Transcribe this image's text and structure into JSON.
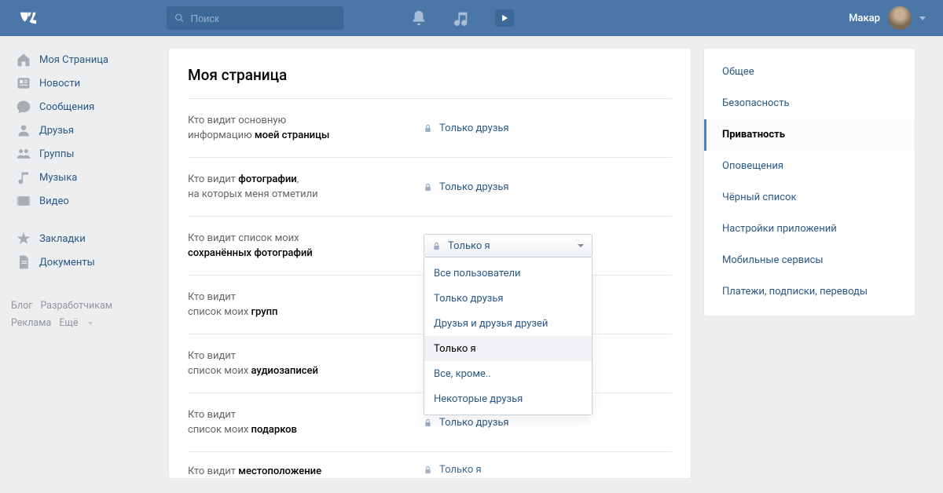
{
  "header": {
    "search_placeholder": "Поиск",
    "username": "Макар"
  },
  "leftnav": {
    "items": [
      {
        "label": "Моя Страница",
        "icon": "home"
      },
      {
        "label": "Новости",
        "icon": "news"
      },
      {
        "label": "Сообщения",
        "icon": "messages"
      },
      {
        "label": "Друзья",
        "icon": "friends"
      },
      {
        "label": "Группы",
        "icon": "groups"
      },
      {
        "label": "Музыка",
        "icon": "music"
      },
      {
        "label": "Видео",
        "icon": "video"
      }
    ],
    "secondary": [
      {
        "label": "Закладки",
        "icon": "bookmarks"
      },
      {
        "label": "Документы",
        "icon": "docs"
      }
    ],
    "footer": {
      "blog": "Блог",
      "developers": "Разработчикам",
      "ads": "Реклама",
      "more": "Ещё"
    }
  },
  "main": {
    "title": "Моя страница",
    "rows": [
      {
        "q1": "Кто видит основную",
        "q2": "информацию ",
        "b": "моей страницы",
        "value": "Только друзья"
      },
      {
        "q1": "Кто видит ",
        "b1": "фотографии",
        "punc": ",",
        "q2": "на которых меня отметили",
        "value": "Только друзья"
      },
      {
        "q1": "Кто видит список моих",
        "q2": "",
        "b": "сохранённых фотографий",
        "value_dd": "Только я"
      },
      {
        "q1": "Кто видит",
        "q2": "список моих ",
        "b": "групп",
        "value": ""
      },
      {
        "q1": "Кто видит",
        "q2": "список моих ",
        "b": "аудиозаписей",
        "value": ""
      },
      {
        "q1": "Кто видит",
        "q2": "список моих ",
        "b": "подарков",
        "value": "Только друзья"
      },
      {
        "q1": "Кто видит ",
        "b1": "местоположение",
        "q2": "",
        "value": "Только я"
      }
    ],
    "dropdown": {
      "selected": "Только я",
      "options": [
        "Все пользователи",
        "Только друзья",
        "Друзья и друзья друзей",
        "Только я",
        "Все, кроме..",
        "Некоторые друзья"
      ]
    }
  },
  "rightnav": {
    "items": [
      "Общее",
      "Безопасность",
      "Приватность",
      "Оповещения",
      "Чёрный список",
      "Настройки приложений",
      "Мобильные сервисы",
      "Платежи, подписки, переводы"
    ],
    "active": "Приватность"
  }
}
